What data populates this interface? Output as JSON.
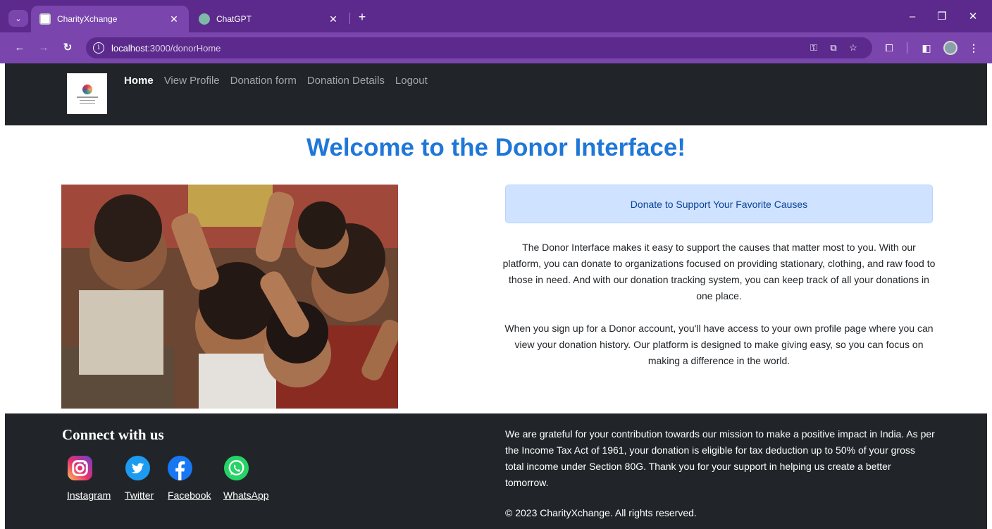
{
  "browser": {
    "tabs": [
      {
        "title": "CharityXchange",
        "active": true
      },
      {
        "title": "ChatGPT",
        "active": false
      }
    ],
    "url_host": "localhost",
    "url_path": ":3000/donorHome",
    "accent_color": "#7a46ad"
  },
  "site": {
    "nav": {
      "links": [
        "Home",
        "View Profile",
        "Donation form",
        "Donation Details",
        "Logout"
      ],
      "active": "Home"
    },
    "welcome_title": "Welcome to the Donor Interface!",
    "alert_text": "Donate to Support Your Favorite Causes",
    "paragraph1": "The Donor Interface makes it easy to support the causes that matter most to you. With our platform, you can donate to organizations focused on providing stationary, clothing, and raw food to those in need. And with our donation tracking system, you can keep track of all your donations in one place.",
    "paragraph2": "When you sign up for a Donor account, you'll have access to your own profile page where you can view your donation history. Our platform is designed to make giving easy, so you can focus on making a difference in the world.",
    "title_color": "#1f77d8"
  },
  "footer": {
    "connect_title": "Connect with us",
    "social": [
      {
        "label": "Instagram",
        "icon": "instagram-icon"
      },
      {
        "label": "Twitter",
        "icon": "twitter-icon"
      },
      {
        "label": "Facebook",
        "icon": "facebook-icon"
      },
      {
        "label": "WhatsApp",
        "icon": "whatsapp-icon"
      }
    ],
    "message": "We are grateful for your contribution towards our mission to make a positive impact in India. As per the Income Tax Act of 1961, your donation is eligible for tax deduction up to 50% of your gross total income under Section 80G. Thank you for your support in helping us create a better tomorrow.",
    "copyright": "© 2023 CharityXchange. All rights reserved."
  }
}
